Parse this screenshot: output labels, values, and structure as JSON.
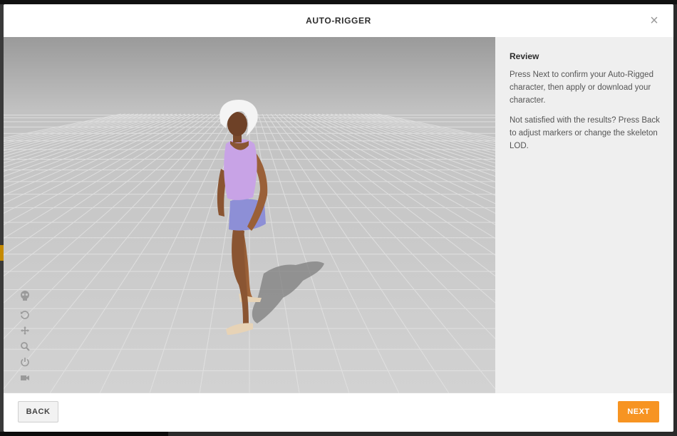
{
  "modal": {
    "title": "AUTO-RIGGER",
    "close_icon": "close-icon"
  },
  "review": {
    "title": "Review",
    "paragraph1": "Press Next to confirm your Auto-Rigged character, then apply or download your character.",
    "paragraph2": "Not satisfied with the results? Press Back to adjust markers or change the skeleton LOD."
  },
  "viewer_tools": [
    {
      "name": "skeleton-icon"
    },
    {
      "name": "rotate-icon"
    },
    {
      "name": "pan-icon"
    },
    {
      "name": "zoom-icon"
    },
    {
      "name": "power-icon"
    },
    {
      "name": "camera-icon"
    }
  ],
  "footer": {
    "back_label": "BACK",
    "next_label": "NEXT"
  },
  "colors": {
    "accent": "#f79422",
    "panel_bg": "#efefef",
    "floor": "#c9c9c9"
  }
}
